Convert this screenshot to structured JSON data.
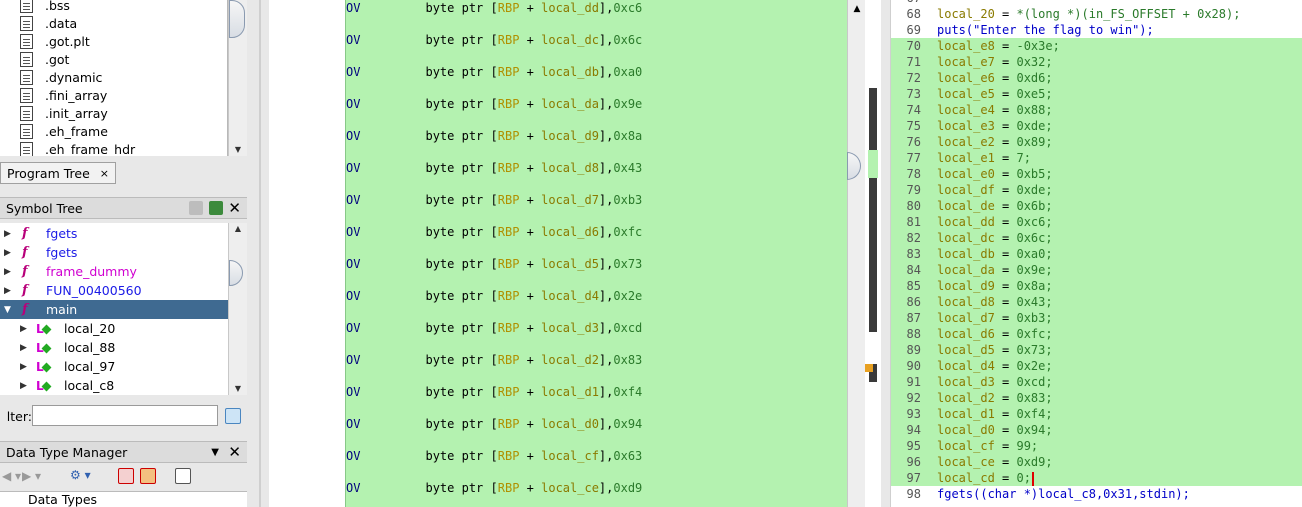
{
  "program_tree": {
    "items": [
      ".bss",
      ".data",
      ".got.plt",
      ".got",
      ".dynamic",
      ".fini_array",
      ".init_array",
      ".eh_frame",
      ".eh_frame_hdr"
    ],
    "tab_label": "Program Tree",
    "tab_close": "×"
  },
  "symbol_tree": {
    "title": "Symbol Tree",
    "close": "✕",
    "items": [
      {
        "label": "fgets",
        "caret": "▶",
        "color": "#1a1ae6"
      },
      {
        "label": "fgets",
        "caret": "▶",
        "color": "#1a1ae6"
      },
      {
        "label": "frame_dummy",
        "caret": "▶",
        "color": "#d000d0"
      },
      {
        "label": "FUN_00400560",
        "caret": "▶",
        "color": "#1a1ae6"
      },
      {
        "label": "main",
        "caret": "▼",
        "color": "#ffffff"
      }
    ],
    "children": [
      "local_20",
      "local_88",
      "local_97",
      "local_c8"
    ]
  },
  "filter": {
    "label": "lter:",
    "value": ""
  },
  "data_type_manager": {
    "title": "Data Type Manager",
    "close": "✕",
    "root_label": "Data Types"
  },
  "listing": {
    "mnemonic": "OV",
    "operand_prefix": "byte ptr ",
    "register": "RBP",
    "rows": [
      {
        "var": "local_dd",
        "imm": "0xc6"
      },
      {
        "var": "local_dc",
        "imm": "0x6c"
      },
      {
        "var": "local_db",
        "imm": "0xa0"
      },
      {
        "var": "local_da",
        "imm": "0x9e"
      },
      {
        "var": "local_d9",
        "imm": "0x8a"
      },
      {
        "var": "local_d8",
        "imm": "0x43"
      },
      {
        "var": "local_d7",
        "imm": "0xb3"
      },
      {
        "var": "local_d6",
        "imm": "0xfc"
      },
      {
        "var": "local_d5",
        "imm": "0x73"
      },
      {
        "var": "local_d4",
        "imm": "0x2e"
      },
      {
        "var": "local_d3",
        "imm": "0xcd"
      },
      {
        "var": "local_d2",
        "imm": "0x83"
      },
      {
        "var": "local_d1",
        "imm": "0xf4"
      },
      {
        "var": "local_d0",
        "imm": "0x94"
      },
      {
        "var": "local_cf",
        "imm": "0x63"
      },
      {
        "var": "local_ce",
        "imm": "0xd9"
      }
    ]
  },
  "decompiler": {
    "top_partial_line": "67",
    "lines": [
      {
        "n": "68",
        "var": "local_20",
        "rhs": "*(long *)(in_FS_OFFSET + 0x28);"
      },
      {
        "n": "69",
        "raw": "puts(\"Enter the flag to win\");"
      },
      {
        "n": "70",
        "var": "local_e8",
        "rhs": "-0x3e;"
      },
      {
        "n": "71",
        "var": "local_e7",
        "rhs": "0x32;"
      },
      {
        "n": "72",
        "var": "local_e6",
        "rhs": "0xd6;"
      },
      {
        "n": "73",
        "var": "local_e5",
        "rhs": "0xe5;"
      },
      {
        "n": "74",
        "var": "local_e4",
        "rhs": "0x88;"
      },
      {
        "n": "75",
        "var": "local_e3",
        "rhs": "0xde;"
      },
      {
        "n": "76",
        "var": "local_e2",
        "rhs": "0x89;"
      },
      {
        "n": "77",
        "var": "local_e1",
        "rhs": "7;"
      },
      {
        "n": "78",
        "var": "local_e0",
        "rhs": "0xb5;"
      },
      {
        "n": "79",
        "var": "local_df",
        "rhs": "0xde;"
      },
      {
        "n": "80",
        "var": "local_de",
        "rhs": "0x6b;"
      },
      {
        "n": "81",
        "var": "local_dd",
        "rhs": "0xc6;"
      },
      {
        "n": "82",
        "var": "local_dc",
        "rhs": "0x6c;"
      },
      {
        "n": "83",
        "var": "local_db",
        "rhs": "0xa0;"
      },
      {
        "n": "84",
        "var": "local_da",
        "rhs": "0x9e;"
      },
      {
        "n": "85",
        "var": "local_d9",
        "rhs": "0x8a;"
      },
      {
        "n": "86",
        "var": "local_d8",
        "rhs": "0x43;"
      },
      {
        "n": "87",
        "var": "local_d7",
        "rhs": "0xb3;"
      },
      {
        "n": "88",
        "var": "local_d6",
        "rhs": "0xfc;"
      },
      {
        "n": "89",
        "var": "local_d5",
        "rhs": "0x73;"
      },
      {
        "n": "90",
        "var": "local_d4",
        "rhs": "0x2e;"
      },
      {
        "n": "91",
        "var": "local_d3",
        "rhs": "0xcd;"
      },
      {
        "n": "92",
        "var": "local_d2",
        "rhs": "0x83;"
      },
      {
        "n": "93",
        "var": "local_d1",
        "rhs": "0xf4;"
      },
      {
        "n": "94",
        "var": "local_d0",
        "rhs": "0x94;"
      },
      {
        "n": "95",
        "var": "local_cf",
        "rhs": "99;"
      },
      {
        "n": "96",
        "var": "local_ce",
        "rhs": "0xd9;"
      },
      {
        "n": "97",
        "var": "local_cd",
        "rhs": "0;"
      },
      {
        "n": "98",
        "raw": "fgets((char *)local_c8,0x31,stdin);"
      }
    ]
  },
  "colors": {
    "highlight": "#b4f2b0",
    "selection": "#3f6a91",
    "cursor": "#e00000"
  }
}
